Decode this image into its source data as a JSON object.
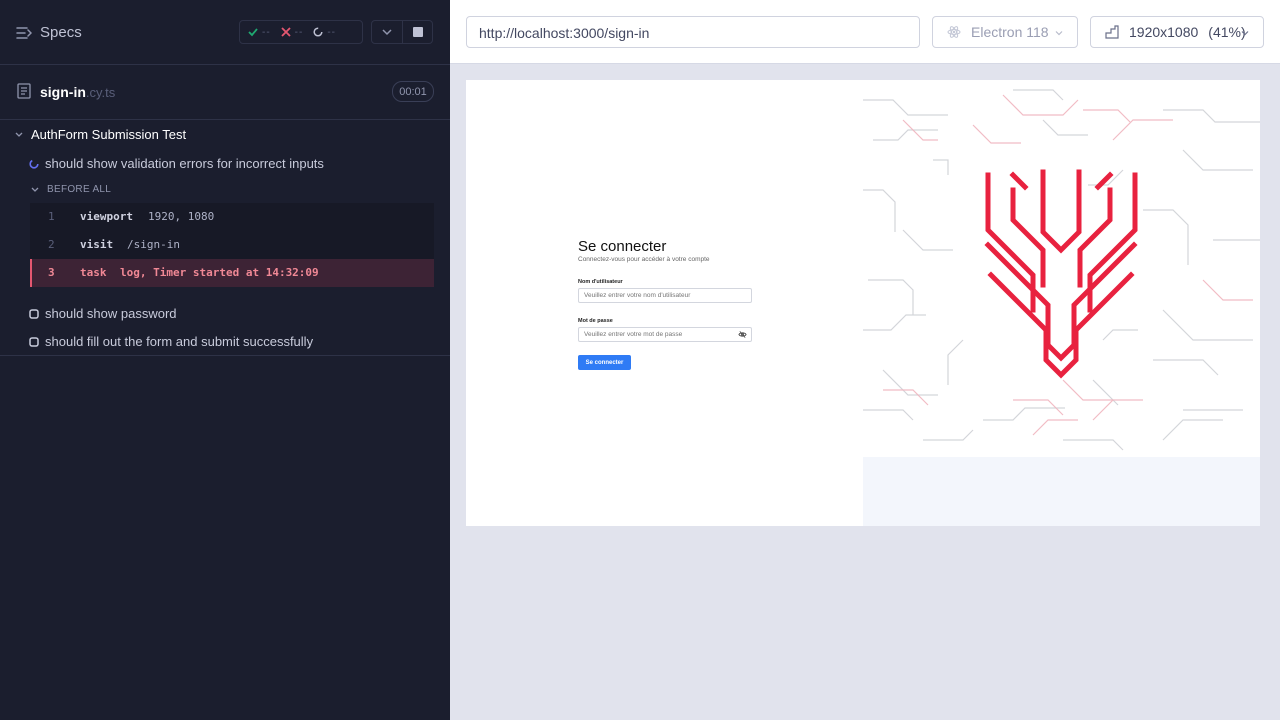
{
  "reporter": {
    "specs_label": "Specs",
    "stats": {
      "passed": "--",
      "failed": "--",
      "pending": "--"
    },
    "file": {
      "name": "sign-in",
      "ext": ".cy.ts",
      "duration": "00:01"
    },
    "suite": {
      "title": "AuthForm Submission Test"
    },
    "tests": [
      {
        "title": "should show validation errors for incorrect inputs",
        "state": "running"
      },
      {
        "title": "should show password",
        "state": "queued"
      },
      {
        "title": "should fill out the form and submit successfully",
        "state": "queued"
      }
    ],
    "hook": {
      "title": "BEFORE ALL"
    },
    "commands": [
      {
        "num": "1",
        "name": "viewport",
        "message": "1920, 1080"
      },
      {
        "num": "2",
        "name": "visit",
        "message": "/sign-in"
      },
      {
        "num": "3",
        "name": "task",
        "message": "log, Timer started at 14:32:09"
      }
    ]
  },
  "runner": {
    "url": "http://localhost:3000/sign-in",
    "browser": "Electron 118",
    "viewport": "1920x1080",
    "scale": "(41%)"
  },
  "app": {
    "title": "Se connecter",
    "subtitle": "Connectez-vous pour accéder à votre compte",
    "username_label": "Nom d'utilisateur",
    "username_placeholder": "Veuillez entrer votre nom d'utilisateur",
    "password_label": "Mot de passe",
    "password_placeholder": "Veuillez entrer votre mot de passe",
    "submit_label": "Se connecter"
  },
  "colors": {
    "reporter_bg": "#1b1e2e",
    "pass": "#1fa971",
    "fail": "#e45770",
    "running": "#6470f3",
    "brand_red": "#e8223f",
    "submit_blue": "#2f7bf5"
  }
}
